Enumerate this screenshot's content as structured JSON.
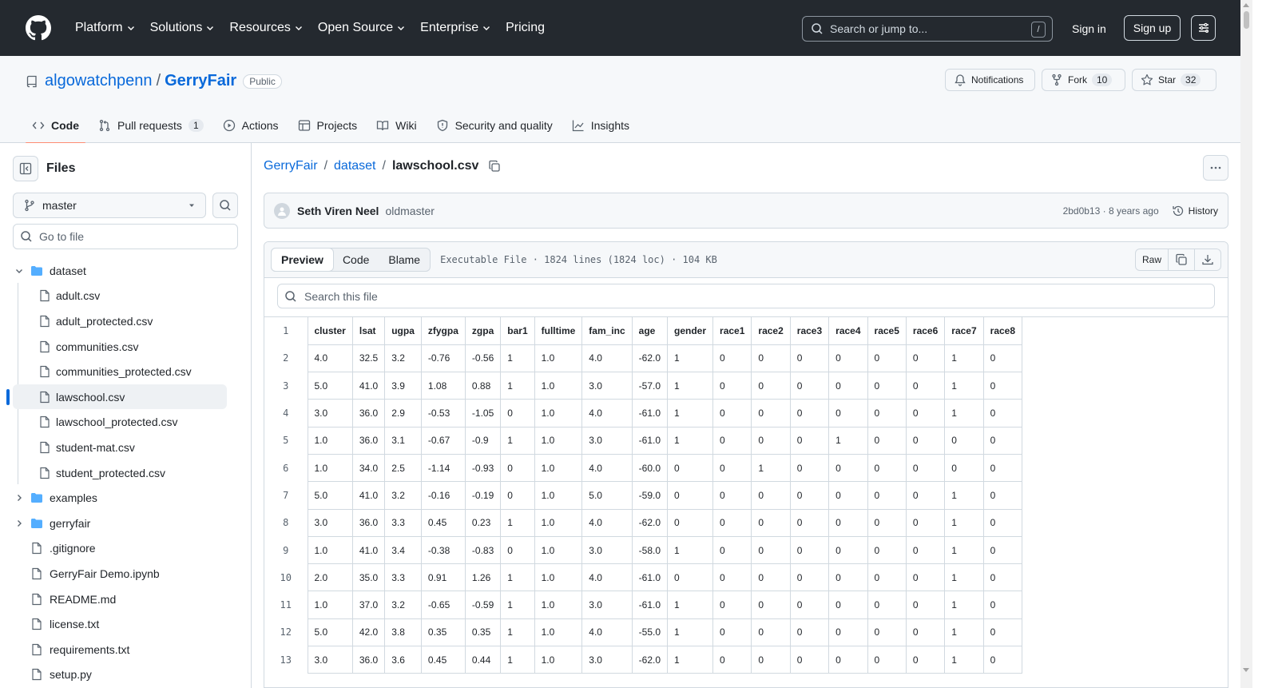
{
  "header": {
    "nav": [
      "Platform",
      "Solutions",
      "Resources",
      "Open Source",
      "Enterprise",
      "Pricing"
    ],
    "search_placeholder": "Search or jump to...",
    "search_shortcut": "/",
    "signin": "Sign in",
    "signup": "Sign up"
  },
  "repo": {
    "owner": "algowatchpenn",
    "separator": "/",
    "name": "GerryFair",
    "visibility": "Public",
    "notifications": "Notifications",
    "fork_label": "Fork",
    "fork_count": "10",
    "star_label": "Star",
    "star_count": "32",
    "tabs": {
      "code": "Code",
      "pulls": "Pull requests",
      "pulls_count": "1",
      "actions": "Actions",
      "projects": "Projects",
      "wiki": "Wiki",
      "security": "Security and quality",
      "insights": "Insights"
    }
  },
  "sidebar": {
    "title": "Files",
    "branch": "master",
    "goto_placeholder": "Go to file",
    "tree": {
      "dataset": "dataset",
      "files": [
        "adult.csv",
        "adult_protected.csv",
        "communities.csv",
        "communities_protected.csv",
        "lawschool.csv",
        "lawschool_protected.csv",
        "student-mat.csv",
        "student_protected.csv"
      ],
      "examples": "examples",
      "gerryfair": "gerryfair",
      "root_files": [
        ".gitignore",
        "GerryFair Demo.ipynb",
        "README.md",
        "license.txt",
        "requirements.txt",
        "setup.py"
      ]
    }
  },
  "breadcrumb": {
    "repo": "GerryFair",
    "dir": "dataset",
    "file": "lawschool.csv",
    "sep": "/"
  },
  "commit": {
    "author": "Seth Viren Neel",
    "message": "oldmaster",
    "meta": "2bd0b13 · 8 years ago",
    "history": "History"
  },
  "file": {
    "tabs": [
      "Preview",
      "Code",
      "Blame"
    ],
    "info": "Executable File · 1824 lines (1824 loc) · 104 KB",
    "raw": "Raw",
    "search_placeholder": "Search this file"
  },
  "csv": {
    "headers": [
      "cluster",
      "lsat",
      "ugpa",
      "zfygpa",
      "zgpa",
      "bar1",
      "fulltime",
      "fam_inc",
      "age",
      "gender",
      "race1",
      "race2",
      "race3",
      "race4",
      "race5",
      "race6",
      "race7",
      "race8"
    ],
    "rows": [
      [
        "4.0",
        "32.5",
        "3.2",
        "-0.76",
        "-0.56",
        "1",
        "1.0",
        "4.0",
        "-62.0",
        "1",
        "0",
        "0",
        "0",
        "0",
        "0",
        "0",
        "1",
        "0"
      ],
      [
        "5.0",
        "41.0",
        "3.9",
        "1.08",
        "0.88",
        "1",
        "1.0",
        "3.0",
        "-57.0",
        "1",
        "0",
        "0",
        "0",
        "0",
        "0",
        "0",
        "1",
        "0"
      ],
      [
        "3.0",
        "36.0",
        "2.9",
        "-0.53",
        "-1.05",
        "0",
        "1.0",
        "4.0",
        "-61.0",
        "1",
        "0",
        "0",
        "0",
        "0",
        "0",
        "0",
        "1",
        "0"
      ],
      [
        "1.0",
        "36.0",
        "3.1",
        "-0.67",
        "-0.9",
        "1",
        "1.0",
        "3.0",
        "-61.0",
        "1",
        "0",
        "0",
        "0",
        "1",
        "0",
        "0",
        "0",
        "0"
      ],
      [
        "1.0",
        "34.0",
        "2.5",
        "-1.14",
        "-0.93",
        "0",
        "1.0",
        "4.0",
        "-60.0",
        "0",
        "0",
        "1",
        "0",
        "0",
        "0",
        "0",
        "0",
        "0"
      ],
      [
        "5.0",
        "41.0",
        "3.2",
        "-0.16",
        "-0.19",
        "0",
        "1.0",
        "5.0",
        "-59.0",
        "0",
        "0",
        "0",
        "0",
        "0",
        "0",
        "0",
        "1",
        "0"
      ],
      [
        "3.0",
        "36.0",
        "3.3",
        "0.45",
        "0.23",
        "1",
        "1.0",
        "4.0",
        "-62.0",
        "0",
        "0",
        "0",
        "0",
        "0",
        "0",
        "0",
        "1",
        "0"
      ],
      [
        "1.0",
        "41.0",
        "3.4",
        "-0.38",
        "-0.83",
        "0",
        "1.0",
        "3.0",
        "-58.0",
        "1",
        "0",
        "0",
        "0",
        "0",
        "0",
        "0",
        "1",
        "0"
      ],
      [
        "2.0",
        "35.0",
        "3.3",
        "0.91",
        "1.26",
        "1",
        "1.0",
        "4.0",
        "-61.0",
        "0",
        "0",
        "0",
        "0",
        "0",
        "0",
        "0",
        "1",
        "0"
      ],
      [
        "1.0",
        "37.0",
        "3.2",
        "-0.65",
        "-0.59",
        "1",
        "1.0",
        "3.0",
        "-61.0",
        "1",
        "0",
        "0",
        "0",
        "0",
        "0",
        "0",
        "1",
        "0"
      ],
      [
        "5.0",
        "42.0",
        "3.8",
        "0.35",
        "0.35",
        "1",
        "1.0",
        "4.0",
        "-55.0",
        "1",
        "0",
        "0",
        "0",
        "0",
        "0",
        "0",
        "1",
        "0"
      ],
      [
        "3.0",
        "36.0",
        "3.6",
        "0.45",
        "0.44",
        "1",
        "1.0",
        "3.0",
        "-62.0",
        "1",
        "0",
        "0",
        "0",
        "0",
        "0",
        "0",
        "1",
        "0"
      ]
    ]
  }
}
